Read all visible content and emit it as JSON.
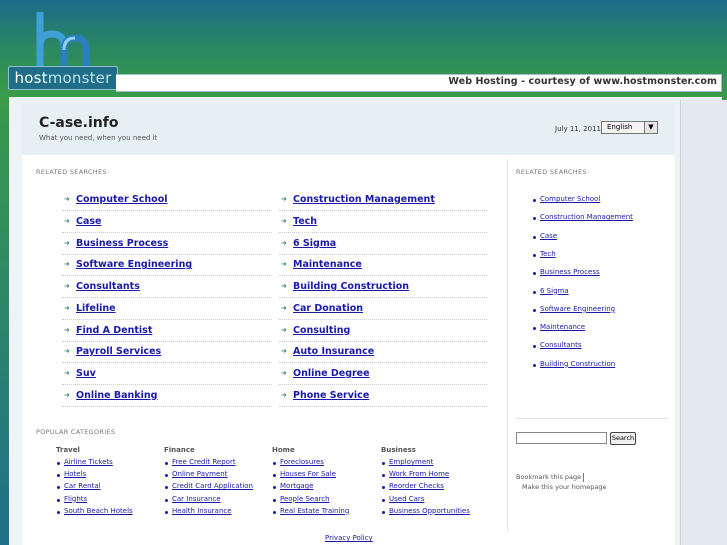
{
  "branding": {
    "logo_letters": "hm",
    "logo_word_part1": "host",
    "logo_word_part2": "monster",
    "topbar_text": "Web Hosting - courtesy of www.hostmonster.com"
  },
  "header": {
    "site_title": "C-ase.info",
    "tagline": "What you need, when you need it",
    "date": "July 11, 2011",
    "language": "English",
    "language_btn": "▼"
  },
  "main": {
    "related_label": "RELATED SEARCHES",
    "left_links": [
      "Computer School",
      "Case",
      "Business Process",
      "Software Engineering",
      "Consultants",
      "Lifeline",
      "Find A Dentist",
      "Payroll Services",
      "Suv",
      "Online Banking"
    ],
    "right_links": [
      "Construction Management",
      "Tech",
      "6 Sigma",
      "Maintenance",
      "Building Construction",
      "Car Donation",
      "Consulting",
      "Auto Insurance",
      "Online Degree",
      "Phone Service"
    ],
    "arrow_glyph": "➜"
  },
  "popular": {
    "label": "POPULAR CATEGORIES",
    "columns": [
      {
        "head": "Travel",
        "items": [
          "Airline Tickets",
          "Hotels",
          "Car Rental",
          "Flights",
          "South Beach Hotels"
        ]
      },
      {
        "head": "Finance",
        "items": [
          "Free Credit Report",
          "Online Payment",
          "Credit Card Application",
          "Car Insurance",
          "Health Insurance"
        ]
      },
      {
        "head": "Home",
        "items": [
          "Foreclosures",
          "Houses For Sale",
          "Mortgage",
          "People Search",
          "Real Estate Training"
        ]
      },
      {
        "head": "Business",
        "items": [
          "Employment",
          "Work From Home",
          "Reorder Checks",
          "Used Cars",
          "Business Opportunities"
        ]
      }
    ]
  },
  "sidebar": {
    "related_label": "RELATED SEARCHES",
    "links": [
      "Computer School",
      "Construction Management",
      "Case",
      "Tech",
      "Business Process",
      "6 Sigma",
      "Software Engineering",
      "Maintenance",
      "Consultants",
      "Building Construction"
    ],
    "search_button": "Search",
    "bookmark": "Bookmark this page",
    "homepage": "Make this your homepage"
  },
  "footer": {
    "privacy": "Privacy Policy"
  },
  "colors": {
    "link": "#1a1aa8",
    "brand_green": "#3a9a4a",
    "brand_blue": "#1f6d86"
  }
}
